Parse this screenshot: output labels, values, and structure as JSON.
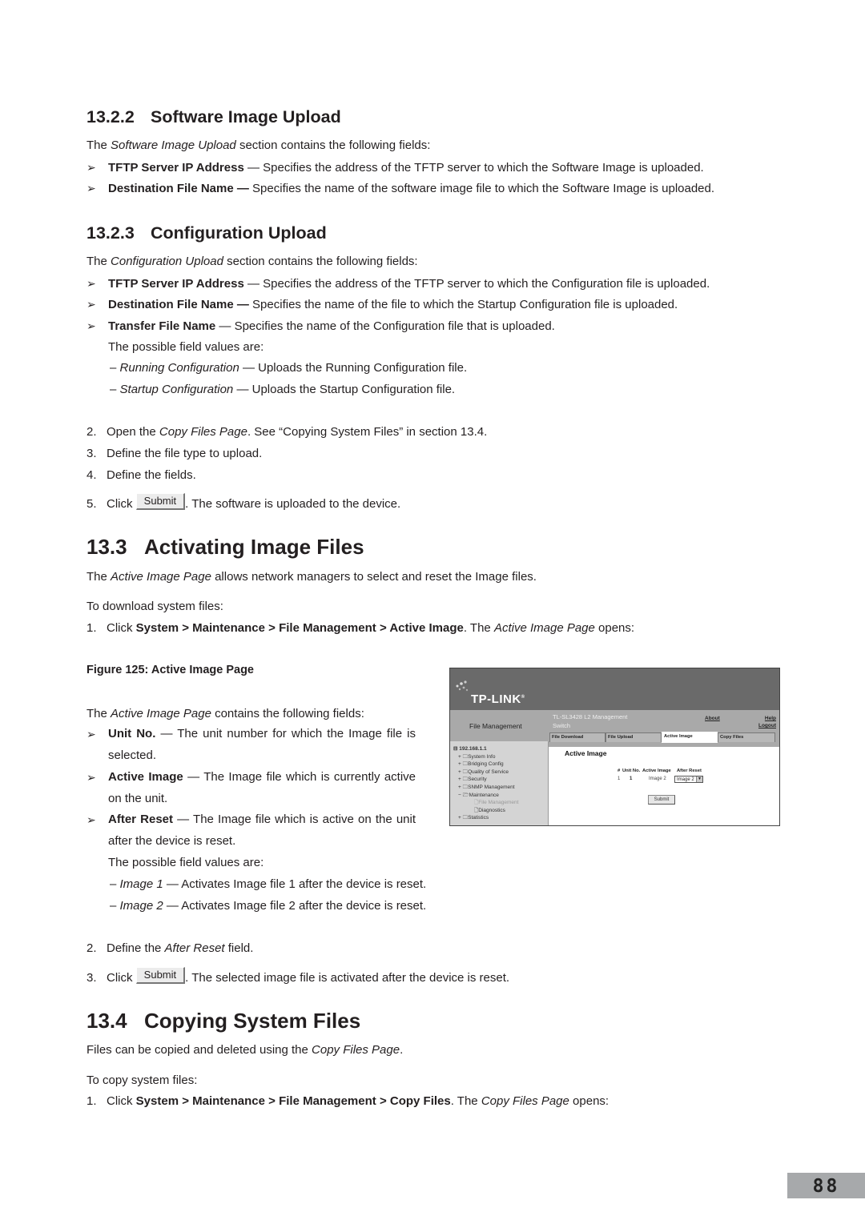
{
  "sections": {
    "s1322": {
      "number": "13.2.2",
      "title": "Software Image Upload",
      "intro_pre": "The ",
      "intro_em": "Software Image Upload",
      "intro_post": " section contains the following fields:",
      "bullets": [
        {
          "term": "TFTP Server IP Address",
          "text": " — Specifies the address of the TFTP server to which the Software Image is uploaded."
        },
        {
          "term": "Destination File Name —",
          "text": " Specifies the name of the software image file to which the Software Image is uploaded."
        }
      ]
    },
    "s1323": {
      "number": "13.2.3",
      "title": "Configuration Upload",
      "intro_pre": "The ",
      "intro_em": "Configuration Upload",
      "intro_post": " section contains the following fields:",
      "bullets": [
        {
          "term": "TFTP Server IP Address",
          "text": " — Specifies the address of the TFTP server to which the Configuration file is uploaded."
        },
        {
          "term": "Destination File Name —",
          "text": " Specifies the name of the file to which the Startup Configuration file is uploaded."
        },
        {
          "term": "Transfer File Name",
          "text": " — Specifies the name of the Configuration file that is uploaded."
        }
      ],
      "possible_values_label": "The possible field values are:",
      "values": [
        {
          "dash": "– ",
          "em": "Running Configuration",
          "text": " — Uploads the Running Configuration file."
        },
        {
          "dash": "– ",
          "em": "Startup Configuration",
          "text": " — Uploads the Startup Configuration file."
        }
      ],
      "steps": [
        {
          "n": "2.",
          "pre": "Open the ",
          "em": "Copy Files Page",
          "post": ". See “Copying System Files” in section 13.4."
        },
        {
          "n": "3.",
          "text": "Define the file type to upload."
        },
        {
          "n": "4.",
          "text": "Define the fields."
        },
        {
          "n": "5.",
          "pre": "Click ",
          "button": "Submit",
          "post": ". The software is uploaded to the device."
        }
      ]
    },
    "s133": {
      "number": "13.3",
      "title": "Activating Image Files",
      "intro_pre": "The ",
      "intro_em": "Active Image Page",
      "intro_post": " allows network managers to select and reset the Image files.",
      "to_download": "To download system files:",
      "step1": {
        "n": "1.",
        "pre": "Click ",
        "path": "System > Maintenance > File Management > Active Image",
        "mid": ". The ",
        "em": "Active Image Page",
        "post": " opens:"
      },
      "figure_caption": "Figure 125: Active Image Page",
      "fields_pre": "The ",
      "fields_em": "Active Image Page",
      "fields_post": " contains the following fields:",
      "bullets": [
        {
          "term": "Unit No.",
          "text": " — The unit number for which the Image file is selected."
        },
        {
          "term": "Active Image",
          "text": " — The Image file which is currently active on the unit."
        },
        {
          "term": "After Reset",
          "text": " — The Image file which is active on the unit after the device is reset."
        }
      ],
      "possible_values_label": "The possible field values are:",
      "values": [
        {
          "dash": "– ",
          "em": "Image 1",
          "text": " — Activates Image file 1 after the device is reset."
        },
        {
          "dash": "– ",
          "em": "Image 2",
          "text": " — Activates Image file 2 after the device is reset."
        }
      ],
      "step2": {
        "n": "2.",
        "pre": "Define the ",
        "em": "After Reset",
        "post": " field."
      },
      "step3": {
        "n": "3.",
        "pre": "Click ",
        "button": "Submit",
        "post": ". The selected image file is activated after the device is reset."
      }
    },
    "s134": {
      "number": "13.4",
      "title": "Copying System Files",
      "intro_pre": "Files can be copied and deleted using the ",
      "intro_em": "Copy Files Page",
      "intro_post": ".",
      "to_copy": "To copy system files:",
      "step1": {
        "n": "1.",
        "pre": "Click ",
        "path": "System > Maintenance > File Management > Copy Files",
        "mid": ". The ",
        "em": "Copy Files Page",
        "post": " opens:"
      }
    }
  },
  "screenshot": {
    "logo": "TP-LINK",
    "logo_mark": "®",
    "section_label": "File Management",
    "device_title_line1": "TL-SL3428 L2 Management",
    "device_title_line2": "Switch",
    "about": "About",
    "help": "Help",
    "logout": "Logout",
    "tabs": [
      "File Download",
      "File Upload",
      "Active Image",
      "Copy Files"
    ],
    "active_tab": "Active Image",
    "tree": {
      "root": "192.168.1.1",
      "items": [
        "System Info",
        "Bridging Config",
        "Quality of Service",
        "Security",
        "SNMP Management",
        "Maintenance"
      ],
      "children": [
        "File Management",
        "Diagnostics"
      ],
      "last": "Statistics"
    },
    "main_title": "Active Image",
    "table_headers": [
      "#",
      "Unit No.",
      "Active Image",
      "After Reset"
    ],
    "row": {
      "index": "1",
      "unit": "1",
      "active_image": "Image 2",
      "after_reset": "Image 2"
    },
    "submit": "Submit"
  },
  "page_number": "88"
}
